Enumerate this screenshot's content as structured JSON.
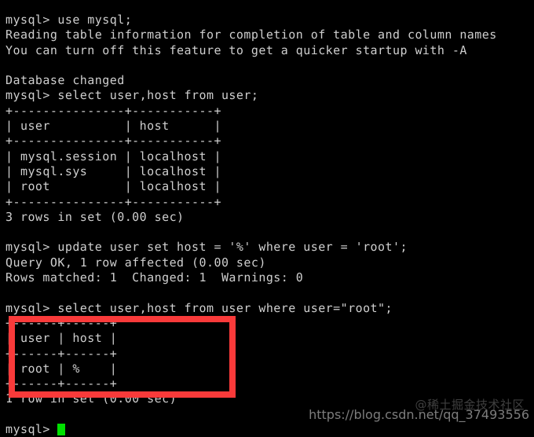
{
  "terminal": {
    "app": "mysql-client-terminal",
    "background_color": "#000000",
    "text_color": "#cfcfcf",
    "cursor_color": "#00e000",
    "lines": [
      "mysql> use mysql;",
      "Reading table information for completion of table and column names",
      "You can turn off this feature to get a quicker startup with -A",
      "",
      "Database changed",
      "mysql> select user,host from user;",
      "+---------------+-----------+",
      "| user          | host      |",
      "+---------------+-----------+",
      "| mysql.session | localhost |",
      "| mysql.sys     | localhost |",
      "| root          | localhost |",
      "+---------------+-----------+",
      "3 rows in set (0.00 sec)",
      "",
      "mysql> update user set host = '%' where user = 'root';",
      "Query OK, 1 row affected (0.00 sec)",
      "Rows matched: 1  Changed: 1  Warnings: 0",
      "",
      "mysql> select user,host from user where user=\"root\";",
      "+------+------+",
      "| user | host |",
      "+------+------+",
      "| root | %    |",
      "+------+------+",
      "1 row in set (0.00 sec)",
      ""
    ],
    "prompt": "mysql> "
  },
  "annotation": {
    "type": "rectangle-highlight",
    "color": "#f93a3a",
    "target": "select user,host from user where user=\"root\" result table"
  },
  "watermark": {
    "cjk_text": "@稀土掘金技术社区",
    "url_text": "https://blog.csdn.net/qq_37493556"
  }
}
